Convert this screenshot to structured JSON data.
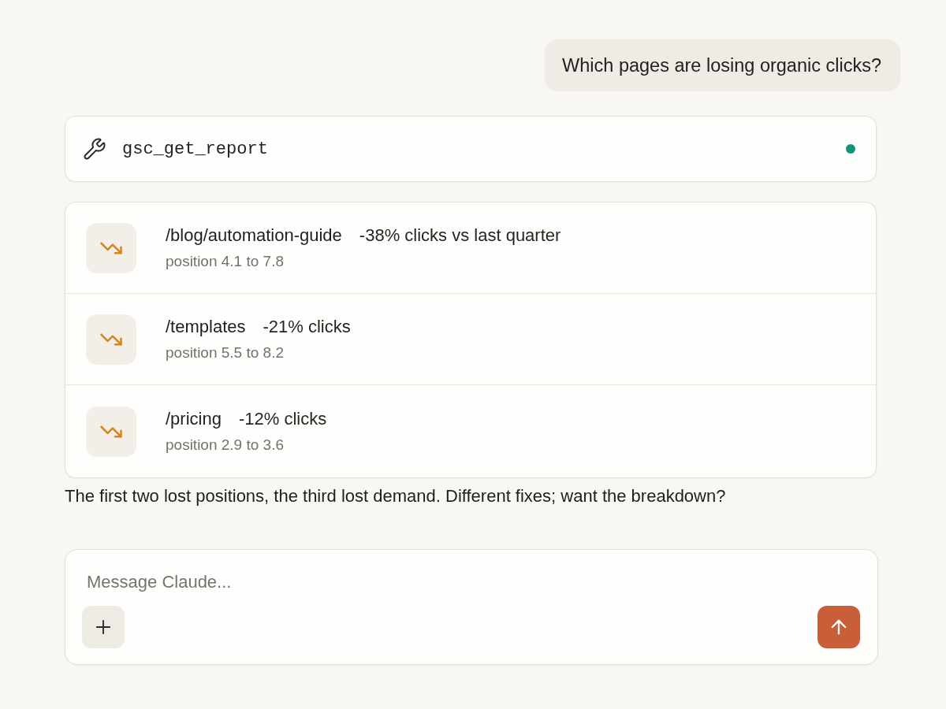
{
  "user_message": {
    "text": "Which pages are losing organic clicks?"
  },
  "tool_call": {
    "name": "gsc_get_report",
    "done": true
  },
  "results": [
    {
      "declining": true,
      "path": "/blog/automation-guide",
      "change": "-38% clicks vs last quarter",
      "detail": "position 4.1 to 7.8"
    },
    {
      "declining": true,
      "path": "/templates",
      "change": "-21% clicks",
      "detail": "position 5.5 to 8.2"
    },
    {
      "declining": true,
      "path": "/pricing",
      "change": "-12% clicks",
      "detail": "position 2.9 to 3.6"
    }
  ],
  "assistant_message": {
    "text": "The first two lost positions, the third lost demand. Different fixes; want the breakdown?"
  },
  "composer": {
    "placeholder": "Message Claude..."
  }
}
